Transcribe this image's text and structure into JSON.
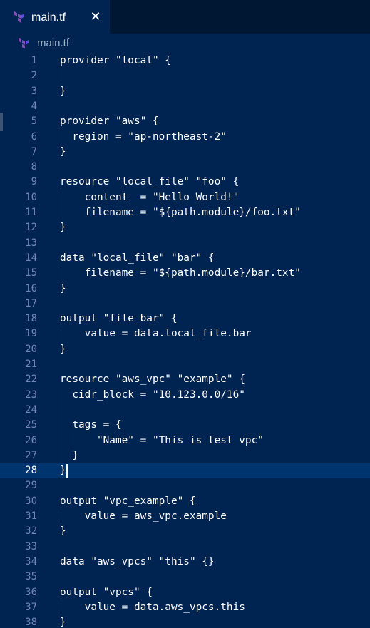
{
  "tab": {
    "label": "main.tf",
    "close_glyph": "✕",
    "icon": "terraform-icon"
  },
  "breadcrumb": {
    "label": "main.tf",
    "icon": "terraform-icon"
  },
  "editor": {
    "active_line": 28,
    "lines": [
      {
        "n": "1",
        "text": "provider \"local\" {"
      },
      {
        "n": "2",
        "text": ""
      },
      {
        "n": "3",
        "text": "}"
      },
      {
        "n": "4",
        "text": ""
      },
      {
        "n": "5",
        "text": "provider \"aws\" {"
      },
      {
        "n": "6",
        "text": "  region = \"ap-northeast-2\""
      },
      {
        "n": "7",
        "text": "}"
      },
      {
        "n": "8",
        "text": ""
      },
      {
        "n": "9",
        "text": "resource \"local_file\" \"foo\" {"
      },
      {
        "n": "10",
        "text": "    content  = \"Hello World!\""
      },
      {
        "n": "11",
        "text": "    filename = \"${path.module}/foo.txt\""
      },
      {
        "n": "12",
        "text": "}"
      },
      {
        "n": "13",
        "text": ""
      },
      {
        "n": "14",
        "text": "data \"local_file\" \"bar\" {"
      },
      {
        "n": "15",
        "text": "    filename = \"${path.module}/bar.txt\""
      },
      {
        "n": "16",
        "text": "}"
      },
      {
        "n": "17",
        "text": ""
      },
      {
        "n": "18",
        "text": "output \"file_bar\" {"
      },
      {
        "n": "19",
        "text": "    value = data.local_file.bar"
      },
      {
        "n": "20",
        "text": "}"
      },
      {
        "n": "21",
        "text": ""
      },
      {
        "n": "22",
        "text": "resource \"aws_vpc\" \"example\" {"
      },
      {
        "n": "23",
        "text": "  cidr_block = \"10.123.0.0/16\""
      },
      {
        "n": "24",
        "text": ""
      },
      {
        "n": "25",
        "text": "  tags = {"
      },
      {
        "n": "26",
        "text": "      \"Name\" = \"This is test vpc\""
      },
      {
        "n": "27",
        "text": "  }"
      },
      {
        "n": "28",
        "text": "}"
      },
      {
        "n": "29",
        "text": ""
      },
      {
        "n": "30",
        "text": "output \"vpc_example\" {"
      },
      {
        "n": "31",
        "text": "    value = aws_vpc.example"
      },
      {
        "n": "32",
        "text": "}"
      },
      {
        "n": "33",
        "text": ""
      },
      {
        "n": "34",
        "text": "data \"aws_vpcs\" \"this\" {}"
      },
      {
        "n": "35",
        "text": ""
      },
      {
        "n": "36",
        "text": "output \"vpcs\" {"
      },
      {
        "n": "37",
        "text": "    value = data.aws_vpcs.this"
      },
      {
        "n": "38",
        "text": "}"
      }
    ]
  },
  "colors": {
    "editor_bg": "#002451",
    "tabbar_bg": "#001733",
    "active_line_bg": "#00346e",
    "line_number": "#7285b7",
    "text": "#ffffff",
    "terraform_purple": "#844fba"
  }
}
